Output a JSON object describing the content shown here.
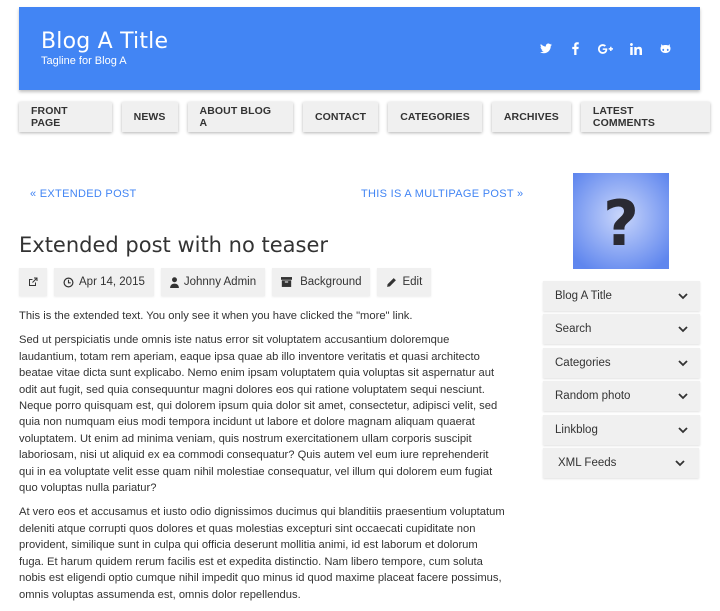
{
  "header": {
    "title": "Blog A Title",
    "tagline": "Tagline for Blog A",
    "bg_color": "#4285f4",
    "social_icons": [
      "twitter-icon",
      "facebook-icon",
      "google-plus-icon",
      "linkedin-icon",
      "github-icon"
    ]
  },
  "nav": {
    "items": [
      "FRONT PAGE",
      "NEWS",
      "ABOUT BLOG A",
      "CONTACT",
      "CATEGORIES",
      "ARCHIVES",
      "LATEST COMMENTS"
    ]
  },
  "pager": {
    "prev": "« EXTENDED POST",
    "next": "THIS IS A MULTIPAGE POST »"
  },
  "post": {
    "title": "Extended post with no teaser",
    "date": "Apr 14, 2015",
    "author": "Johnny Admin",
    "category": "Background",
    "edit": "Edit",
    "paragraphs": [
      "This is the extended text. You only see it when you have clicked the \"more\" link.",
      "Sed ut perspiciatis unde omnis iste natus error sit voluptatem accusantium doloremque laudantium, totam rem aperiam, eaque ipsa quae ab illo inventore veritatis et quasi architecto beatae vitae dicta sunt explicabo. Nemo enim ipsam voluptatem quia voluptas sit aspernatur aut odit aut fugit, sed quia consequuntur magni dolores eos qui ratione voluptatem sequi nesciunt. Neque porro quisquam est, qui dolorem ipsum quia dolor sit amet, consectetur, adipisci velit, sed quia non numquam eius modi tempora incidunt ut labore et dolore magnam aliquam quaerat voluptatem. Ut enim ad minima veniam, quis nostrum exercitationem ullam corporis suscipit laboriosam, nisi ut aliquid ex ea commodi consequatur? Quis autem vel eum iure reprehenderit qui in ea voluptate velit esse quam nihil molestiae consequatur, vel illum qui dolorem eum fugiat quo voluptas nulla pariatur?",
      "At vero eos et accusamus et iusto odio dignissimos ducimus qui blanditiis praesentium voluptatum deleniti atque corrupti quos dolores et quas molestias excepturi sint occaecati cupiditate non provident, similique sunt in culpa qui officia deserunt mollitia animi, id est laborum et dolorum fuga. Et harum quidem rerum facilis est et expedita distinctio. Nam libero tempore, cum soluta nobis est eligendi optio cumque nihil impedit quo minus id quod maxime placeat facere possimus, omnis voluptas assumenda est, omnis dolor repellendus."
    ]
  },
  "sidebar": {
    "photo_icon": "question-mark-icon",
    "widgets": [
      "Blog A Title",
      "Search",
      "Categories",
      "Random photo",
      "Linkblog",
      "XML Feeds"
    ]
  }
}
